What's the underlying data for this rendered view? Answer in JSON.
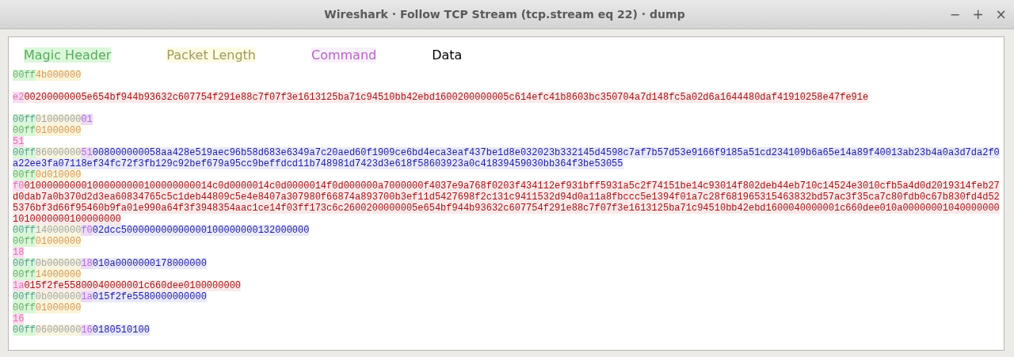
{
  "window": {
    "title": "Wireshark · Follow TCP Stream (tcp.stream eq 22) · dump",
    "controls": [
      {
        "kind": "minimize",
        "glyph": "−"
      },
      {
        "kind": "maximize",
        "glyph": "+"
      },
      {
        "kind": "close",
        "glyph": "×"
      }
    ]
  },
  "legend": [
    {
      "kind": "magic",
      "label": "Magic Header"
    },
    {
      "kind": "length",
      "label": "Packet Length"
    },
    {
      "kind": "command",
      "label": "Command"
    },
    {
      "kind": "data",
      "label": "Data"
    }
  ],
  "blocks": [
    [
      {
        "from_server": false,
        "segments": [
          {
            "kind": "magic",
            "text": "00ff"
          },
          {
            "kind": "length",
            "text": "4b000000"
          }
        ]
      }
    ],
    [
      {
        "from_server": false,
        "segments": [
          {
            "kind": "command",
            "text": "e2"
          },
          {
            "kind": "data",
            "rows": [
              "00200000005e654bf944b93632c607754f291e88c7f07f3e1613125ba71c94510bb42ebd1600200000005c614efc41b8603bc350704a7d148fc5a02d6a1644480daf41910258e47fe91e"
            ]
          }
        ]
      }
    ],
    [
      {
        "from_server": true,
        "segments": [
          {
            "kind": "magic",
            "text": "00ff"
          },
          {
            "kind": "length",
            "text": "01000000"
          },
          {
            "kind": "command",
            "text": "01"
          }
        ]
      },
      {
        "from_server": false,
        "segments": [
          {
            "kind": "magic",
            "text": "00ff"
          },
          {
            "kind": "length",
            "text": "01000000"
          }
        ]
      },
      {
        "from_server": false,
        "segments": [
          {
            "kind": "command",
            "text": "51"
          }
        ]
      },
      {
        "from_server": true,
        "segments": [
          {
            "kind": "magic",
            "text": "00ff"
          },
          {
            "kind": "length",
            "text": "86000000"
          },
          {
            "kind": "command",
            "text": "51"
          },
          {
            "kind": "data",
            "rows": [
              "008000000058aa428e519aec96b58d683e6349a7c20aed60f1909ce6bd4eca3eaf437be1d8e032023b332145d4598c7af7b57d53e9166f9185a51cd234109b6a65e14a89f40013ab23b4a0a3d7da2f0",
              "a22ee3fa07118ef34fc72f3fb129c92bef679a95cc9beffdcd11b748981d7423d3e618f58603923a0c41839459030bb364f3be53055"
            ]
          }
        ]
      },
      {
        "from_server": false,
        "segments": [
          {
            "kind": "magic",
            "text": "00ff"
          },
          {
            "kind": "length",
            "text": "0d010000"
          }
        ]
      },
      {
        "from_server": false,
        "segments": [
          {
            "kind": "command",
            "text": "f0"
          },
          {
            "kind": "data",
            "rows": [
              "010000000001000000000100000000014c0d0000014c0d0000014f0d000000a7000000f4037e9a768f0203f434112ef931bff5931a5c2f74151be14c93014f802deb44eb710c14524e3010cfb5a4d0d2019314feb27",
              "d0dab7a0b370d2d3ea60834765c5c1deb44809c5e4e8407a307980f66874a893700b3ef11d5427698f2c131c9411532d94d0a11a8fbccc5e1394f01a7c28f681965315463832bd57ac3f35ca7c80fdb0c67b830fd4d52",
              "5376bf3d66f95460b9fa01e990a64f3f3948354aac1ce14f03ff173c6c2600200000005e654bf944b93632c607754f291e88c7f07f3e1613125ba71c94510bb42ebd1600040000001c660dee010a00000001040000000",
              "1010000000100000000"
            ]
          }
        ]
      },
      {
        "from_server": true,
        "segments": [
          {
            "kind": "magic",
            "text": "00ff"
          },
          {
            "kind": "length",
            "text": "14000000"
          },
          {
            "kind": "command",
            "text": "f0"
          },
          {
            "kind": "data",
            "rows": [
              "02dcc500000000000000100000000132000000"
            ]
          }
        ]
      },
      {
        "from_server": false,
        "segments": [
          {
            "kind": "magic",
            "text": "00ff"
          },
          {
            "kind": "length",
            "text": "01000000"
          }
        ]
      },
      {
        "from_server": false,
        "segments": [
          {
            "kind": "command",
            "text": "18"
          }
        ]
      },
      {
        "from_server": true,
        "segments": [
          {
            "kind": "magic",
            "text": "00ff"
          },
          {
            "kind": "length",
            "text": "0b000000"
          },
          {
            "kind": "command",
            "text": "18"
          },
          {
            "kind": "data",
            "rows": [
              "010a0000000178000000"
            ]
          }
        ]
      },
      {
        "from_server": false,
        "segments": [
          {
            "kind": "magic",
            "text": "00ff"
          },
          {
            "kind": "length",
            "text": "14000000"
          }
        ]
      },
      {
        "from_server": false,
        "segments": [
          {
            "kind": "command",
            "text": "1a"
          },
          {
            "kind": "data",
            "rows": [
              "015f2fe55800040000001c660dee0100000000"
            ]
          }
        ]
      },
      {
        "from_server": true,
        "segments": [
          {
            "kind": "magic",
            "text": "00ff"
          },
          {
            "kind": "length",
            "text": "0b000000"
          },
          {
            "kind": "command",
            "text": "1a"
          },
          {
            "kind": "data",
            "rows": [
              "015f2fe5580000000000"
            ]
          }
        ]
      },
      {
        "from_server": false,
        "segments": [
          {
            "kind": "magic",
            "text": "00ff"
          },
          {
            "kind": "length",
            "text": "01000000"
          }
        ]
      },
      {
        "from_server": false,
        "segments": [
          {
            "kind": "command",
            "text": "16"
          }
        ]
      },
      {
        "from_server": true,
        "segments": [
          {
            "kind": "magic",
            "text": "00ff"
          },
          {
            "kind": "length",
            "text": "06000000"
          },
          {
            "kind": "command",
            "text": "16"
          },
          {
            "kind": "data",
            "rows": [
              "0180510100"
            ]
          }
        ]
      }
    ]
  ]
}
